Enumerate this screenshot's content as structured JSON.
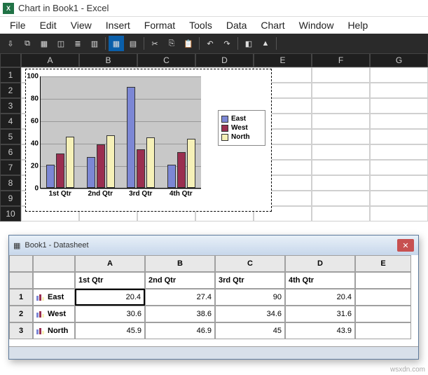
{
  "titlebar": {
    "title": "Chart in Book1 - Excel"
  },
  "menu": [
    "File",
    "Edit",
    "View",
    "Insert",
    "Format",
    "Tools",
    "Data",
    "Chart",
    "Window",
    "Help"
  ],
  "toolbar_icons": [
    "import",
    "data-source",
    "grid",
    "color",
    "by-row",
    "by-column",
    "sep",
    "toggle-grid",
    "toggle-axis",
    "sep",
    "cut",
    "copy",
    "paste",
    "sep",
    "undo",
    "redo",
    "sep",
    "fill",
    "chart-type",
    "sep"
  ],
  "columns": [
    "A",
    "B",
    "C",
    "D",
    "E",
    "F",
    "G"
  ],
  "rows": [
    "1",
    "2",
    "3",
    "4",
    "5",
    "6",
    "7",
    "8",
    "9",
    "10"
  ],
  "legend": [
    {
      "name": "East",
      "color": "#7c87d5"
    },
    {
      "name": "West",
      "color": "#9a2f50"
    },
    {
      "name": "North",
      "color": "#f6f1b8"
    }
  ],
  "datasheet": {
    "title": "Book1 - Datasheet",
    "cols": [
      "A",
      "B",
      "C",
      "D",
      "E"
    ],
    "row_nums": [
      "1",
      "2",
      "3"
    ],
    "col_labels": [
      "1st Qtr",
      "2nd Qtr",
      "3rd Qtr",
      "4th Qtr"
    ],
    "rows": [
      {
        "name": "East",
        "vals": [
          "20.4",
          "27.4",
          "90",
          "20.4"
        ]
      },
      {
        "name": "West",
        "vals": [
          "30.6",
          "38.6",
          "34.6",
          "31.6"
        ]
      },
      {
        "name": "North",
        "vals": [
          "45.9",
          "46.9",
          "45",
          "43.9"
        ]
      }
    ],
    "selected": {
      "row": 0,
      "col": 0
    }
  },
  "chart_data": {
    "type": "bar",
    "title": "",
    "xlabel": "",
    "ylabel": "",
    "ylim": [
      0,
      100
    ],
    "yticks": [
      0,
      20,
      40,
      60,
      80,
      100
    ],
    "categories": [
      "1st Qtr",
      "2nd Qtr",
      "3rd Qtr",
      "4th Qtr"
    ],
    "series": [
      {
        "name": "East",
        "color": "#7c87d5",
        "values": [
          20.4,
          27.4,
          90,
          20.4
        ]
      },
      {
        "name": "West",
        "color": "#9a2f50",
        "values": [
          30.6,
          38.6,
          34.6,
          31.6
        ]
      },
      {
        "name": "North",
        "color": "#f6f1b8",
        "values": [
          45.9,
          46.9,
          45,
          43.9
        ]
      }
    ]
  },
  "watermark": "wsxdn.com"
}
